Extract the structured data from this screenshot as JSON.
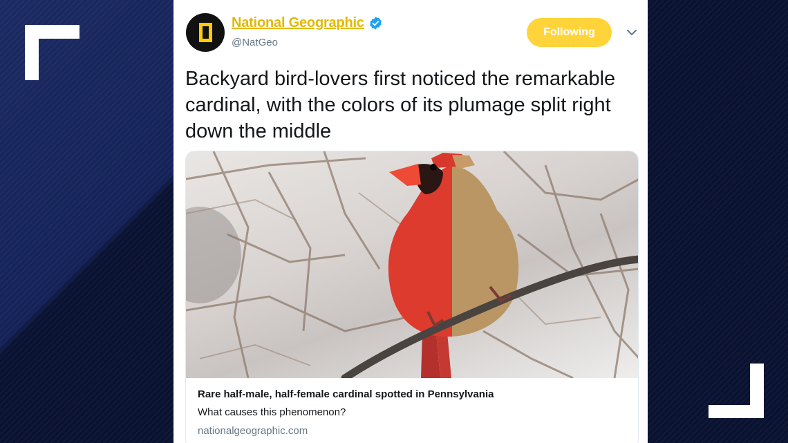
{
  "account": {
    "name": "National Geographic",
    "handle": "@NatGeo",
    "verified": true,
    "follow_label": "Following",
    "brand_color": "#e3b800",
    "follow_color": "#ffd43a"
  },
  "tweet": {
    "text": "Backyard bird-lovers first noticed the remarkable cardinal, with the colors of its plumage split right down the middle"
  },
  "card": {
    "image_alt": "cardinal-photo",
    "title": "Rare half-male, half-female cardinal spotted in Pennsylvania",
    "description": "What causes this phenomenon?",
    "domain": "nationalgeographic.com"
  }
}
